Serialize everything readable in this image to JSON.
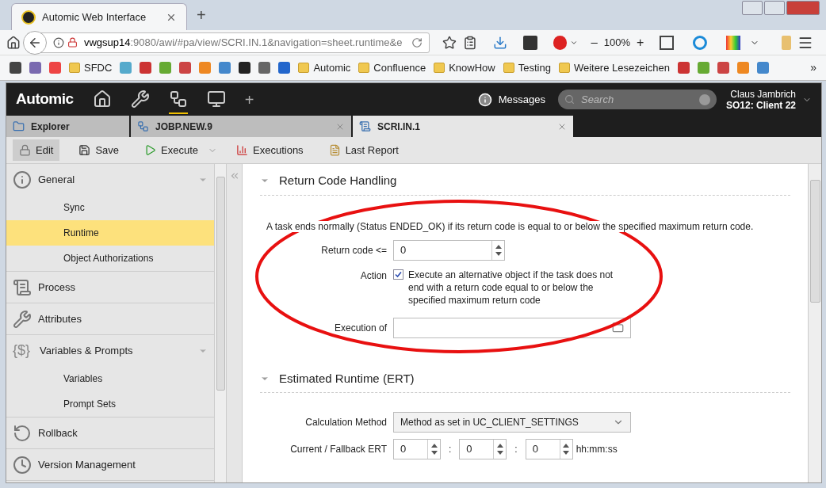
{
  "browser": {
    "tab_title": "Automic Web Interface",
    "new_tab": "+",
    "url_host": "vwgsup14",
    "url_rest": ":9080/awi/#pa/view/SCRI.IN.1&navigation=sheet.runtime&e",
    "zoom_minus": "–",
    "zoom": "100%",
    "zoom_plus": "+",
    "more": "»",
    "bookmarks": [
      {
        "kind": "icon"
      },
      {
        "kind": "icon"
      },
      {
        "kind": "icon"
      },
      {
        "kind": "folder",
        "label": "SFDC"
      },
      {
        "kind": "icon"
      },
      {
        "kind": "icon"
      },
      {
        "kind": "icon"
      },
      {
        "kind": "icon"
      },
      {
        "kind": "icon"
      },
      {
        "kind": "icon"
      },
      {
        "kind": "icon"
      },
      {
        "kind": "icon"
      },
      {
        "kind": "icon"
      },
      {
        "kind": "folder",
        "label": "Automic"
      },
      {
        "kind": "folder",
        "label": "Confluence"
      },
      {
        "kind": "folder",
        "label": "KnowHow"
      },
      {
        "kind": "folder",
        "label": "Testing"
      },
      {
        "kind": "folder",
        "label": "Weitere Lesezeichen"
      },
      {
        "kind": "icon"
      },
      {
        "kind": "icon"
      },
      {
        "kind": "icon"
      },
      {
        "kind": "icon"
      },
      {
        "kind": "icon"
      }
    ]
  },
  "app": {
    "logo": "Automic",
    "nav": [
      {
        "kind": "home",
        "selected": false
      },
      {
        "kind": "tools",
        "selected": false
      },
      {
        "kind": "explorer",
        "selected": true
      },
      {
        "kind": "monitor",
        "selected": false
      }
    ],
    "add": "+",
    "messages": "Messages",
    "search": {
      "placeholder": "Search"
    },
    "user": "Claus Jambrich",
    "client": "SO12: Client 22"
  },
  "tabs": [
    {
      "label": "Explorer",
      "kind": "explorer",
      "selected": false,
      "closable": false
    },
    {
      "label": "JOBP.NEW.9",
      "kind": "workflow",
      "selected": false,
      "closable": true
    },
    {
      "label": "SCRI.IN.1",
      "kind": "script",
      "selected": true,
      "closable": true
    }
  ],
  "toolbar": [
    {
      "label": "Edit",
      "kind": "edit",
      "pressed": true
    },
    {
      "label": "Save",
      "kind": "save",
      "pressed": false
    },
    {
      "label": "Execute",
      "kind": "execute",
      "pressed": false
    },
    {
      "label": "Executions",
      "kind": "executions",
      "pressed": false
    },
    {
      "label": "Last Report",
      "kind": "report",
      "pressed": false
    }
  ],
  "sidebar": [
    {
      "label": "General",
      "kind": "info",
      "expanded": true,
      "children": [
        {
          "label": "Sync",
          "selected": false
        },
        {
          "label": "Runtime",
          "selected": true
        },
        {
          "label": "Object Authorizations",
          "selected": false
        }
      ]
    },
    {
      "label": "Process",
      "kind": "scroll",
      "expanded": false
    },
    {
      "label": "Attributes",
      "kind": "tools",
      "expanded": false
    },
    {
      "label": "Variables & Prompts",
      "kind": "dollar",
      "glyph": "{$}",
      "expanded": true,
      "children": [
        {
          "label": "Variables",
          "selected": false
        },
        {
          "label": "Prompt Sets",
          "selected": false
        }
      ]
    },
    {
      "label": "Rollback",
      "kind": "rollback",
      "expanded": false
    },
    {
      "label": "Version Management",
      "kind": "clock",
      "expanded": false
    }
  ],
  "return_code": {
    "title": "Return Code Handling",
    "description": "A task ends normally (Status ENDED_OK) if its return code is equal to or below the specified maximum return code.",
    "rc_label": "Return code <=",
    "rc_value": "0",
    "action_label": "Action",
    "action_checked": true,
    "action_text": "Execute an alternative object if the task does not end with a return code equal to or below the specified maximum return code",
    "execution_label": "Execution of"
  },
  "ert": {
    "title": "Estimated Runtime (ERT)",
    "method_label": "Calculation Method",
    "method_value": "Method as set in UC_CLIENT_SETTINGS",
    "fallback_label": "Current / Fallback ERT",
    "hours": "0",
    "sep1": ":",
    "minutes": "0",
    "sep2": ":",
    "seconds": "0",
    "unit": "hh:mm:ss"
  }
}
